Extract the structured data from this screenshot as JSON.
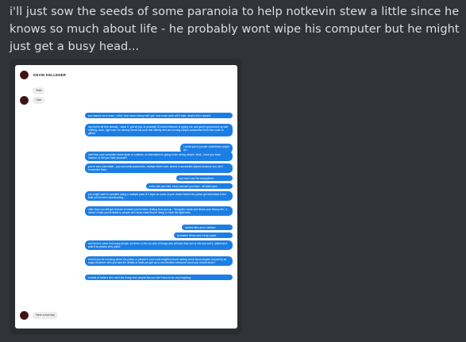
{
  "post": {
    "text": "i'll just sow the seeds of some paranoia to help notkevin stew a little since he knows so much about life - he probably wont wipe his computer but  he might just get a busy head..."
  },
  "screenshot": {
    "contact_name": "KEVIN KELLEHER",
    "incoming": [
      "Yeah",
      "I see",
      "Have a nice day."
    ],
    "outgoing": [
      "you wanna run a scam - think, how much money will i get, how much work will it take, what's risk v reward.",
      "my mom's all free already - value 0. you've put- in probably 20 mins minimum of typing etc, and you're gonna end up with nothing, oooh, right now i've already found out your real identity and am running scripts customised from free code on github.",
      "I invite you to ponder what these scripts do...",
      "next  time your computer slows down or crashes, or information is going to the wrong people, think - have you been hacked, or did you hack yourself?",
      "you're very vulnerable - you use weak passwords, multiple times over, stored in accessible places because you can't remember them.",
      "you don't use 2fa everywhere",
      "every site you visit, every account you have - all wide open",
      "you might want to consider doing a multiple pass ill 0 wipe on some of your drives before the police get interested in the stuff you've been downloading...",
      "often they can still get records of where you've been visiting from you up - 'incognito' mode just clears your history etc., it doesn't make you invisible to people who know what they're doing or have the right tools",
      "deleted files aren't deleted",
      "formatted drives aren't truly wiped",
      "and there's some real scary people out there on the do side of things who will take that sort of info and sell it, distribute it, post it on places very public",
      "should you be worrying about the police or people in your local neighbourhood seeing some flyers stapled around by an angry #channer who just saw the details of what you get up to and decided everyone round you should know?",
      "crowds of fathers who don't like living near people like you don't tend to be very forgiving..."
    ]
  }
}
